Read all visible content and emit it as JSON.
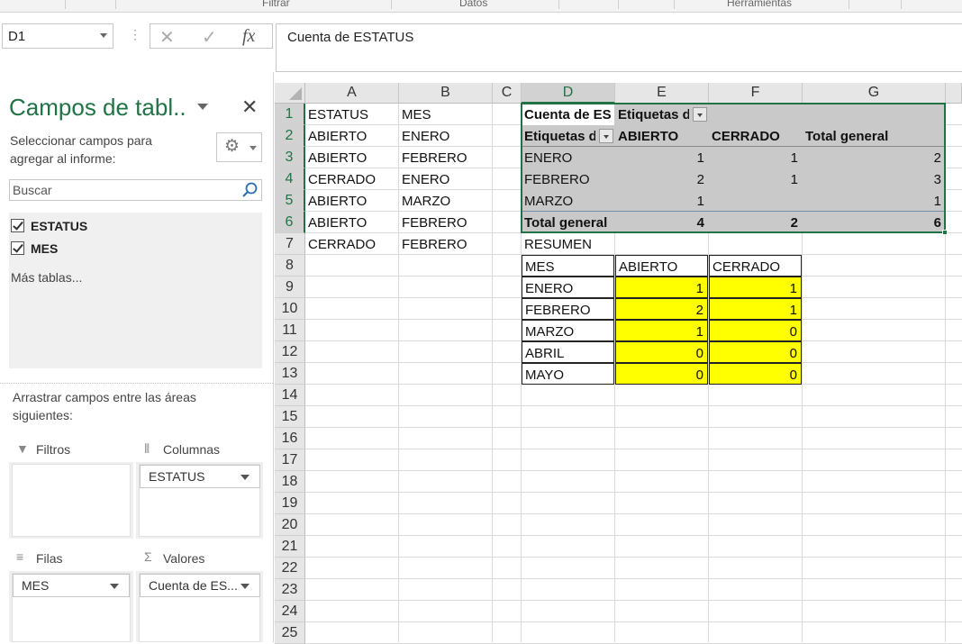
{
  "ribbon": {
    "groups": [
      "Filtrar",
      "Datos",
      "Herramientas"
    ]
  },
  "formula_bar": {
    "name_box": "D1",
    "cancel_glyph": "✕",
    "enter_glyph": "✓",
    "fx_glyph": "fx",
    "content": "Cuenta de ESTATUS"
  },
  "pane": {
    "title": "Campos de tabl..",
    "close_glyph": "✕",
    "description": "Seleccionar campos para agregar al informe:",
    "search_placeholder": "Buscar",
    "fields": [
      {
        "label": "ESTATUS",
        "checked": true
      },
      {
        "label": "MES",
        "checked": true
      }
    ],
    "more_tables": "Más tablas...",
    "drag_hint": "Arrastrar campos entre las áreas siguientes:",
    "areas": {
      "filters": {
        "label": "Filtros",
        "icon": "filter-icon"
      },
      "columns": {
        "label": "Columnas",
        "icon": "columns-icon",
        "item": "ESTATUS"
      },
      "rows": {
        "label": "Filas",
        "icon": "rows-icon",
        "item": "MES"
      },
      "values": {
        "label": "Valores",
        "icon": "sigma-icon",
        "item": "Cuenta de ES..."
      }
    }
  },
  "sheet": {
    "name_box_selected_col": "D",
    "columns": [
      "A",
      "B",
      "C",
      "D",
      "E",
      "F",
      "G"
    ],
    "rows": [
      "1",
      "2",
      "3",
      "4",
      "5",
      "6",
      "7",
      "8",
      "9",
      "10",
      "11",
      "12",
      "13",
      "14",
      "15",
      "16",
      "17",
      "18",
      "19",
      "20",
      "21",
      "22",
      "23",
      "24",
      "25"
    ],
    "source_table": [
      [
        "ESTATUS",
        "MES"
      ],
      [
        "ABIERTO",
        "ENERO"
      ],
      [
        "ABIERTO",
        "FEBRERO"
      ],
      [
        "CERRADO",
        "ENERO"
      ],
      [
        "ABIERTO",
        "MARZO"
      ],
      [
        "ABIERTO",
        "FEBRERO"
      ],
      [
        "CERRADO",
        "FEBRERO"
      ]
    ],
    "pivot": {
      "title": "Cuenta de ES",
      "col_labels": "Etiquetas d",
      "row_labels": "Etiquetas d",
      "headers": [
        "ABIERTO",
        "CERRADO",
        "Total general"
      ],
      "rows": [
        {
          "label": "ENERO",
          "values": [
            "1",
            "1",
            "2"
          ]
        },
        {
          "label": "FEBRERO",
          "values": [
            "2",
            "1",
            "3"
          ]
        },
        {
          "label": "MARZO",
          "values": [
            "1",
            "",
            "1"
          ]
        }
      ],
      "total": {
        "label": "Total general",
        "values": [
          "4",
          "2",
          "6"
        ]
      }
    },
    "summary": {
      "title": "RESUMEN",
      "headers": [
        "MES",
        "ABIERTO",
        "CERRADO"
      ],
      "rows": [
        {
          "label": "ENERO",
          "values": [
            "1",
            "1"
          ]
        },
        {
          "label": "FEBRERO",
          "values": [
            "2",
            "1"
          ]
        },
        {
          "label": "MARZO",
          "values": [
            "1",
            "0"
          ]
        },
        {
          "label": "ABRIL",
          "values": [
            "0",
            "0"
          ]
        },
        {
          "label": "MAYO",
          "values": [
            "0",
            "0"
          ]
        }
      ],
      "highlight_color": "#ffff00"
    },
    "accent_color": "#217346"
  }
}
